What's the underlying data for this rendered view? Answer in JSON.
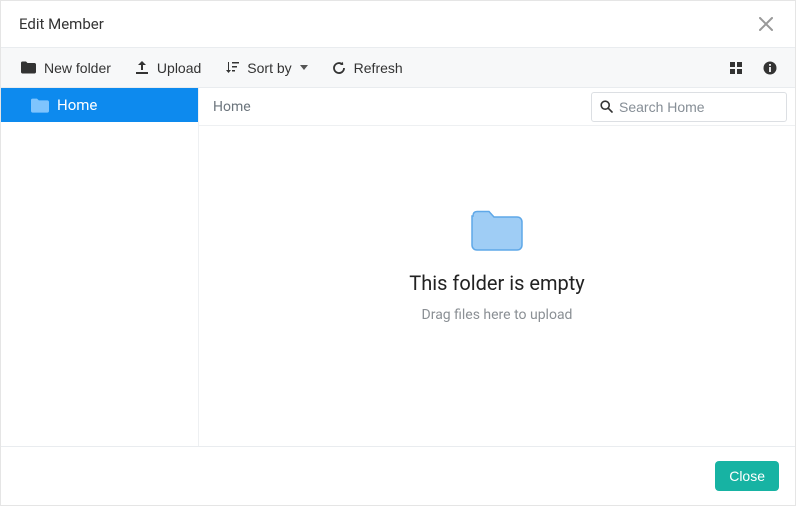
{
  "header": {
    "title": "Edit Member"
  },
  "toolbar": {
    "new_folder": "New folder",
    "upload": "Upload",
    "sort_by": "Sort by",
    "refresh": "Refresh"
  },
  "sidebar": {
    "items": [
      {
        "label": "Home"
      }
    ]
  },
  "breadcrumb": {
    "path": "Home"
  },
  "search": {
    "placeholder": "Search Home"
  },
  "empty": {
    "title": "This folder is empty",
    "subtitle": "Drag files here to upload"
  },
  "footer": {
    "close": "Close"
  }
}
